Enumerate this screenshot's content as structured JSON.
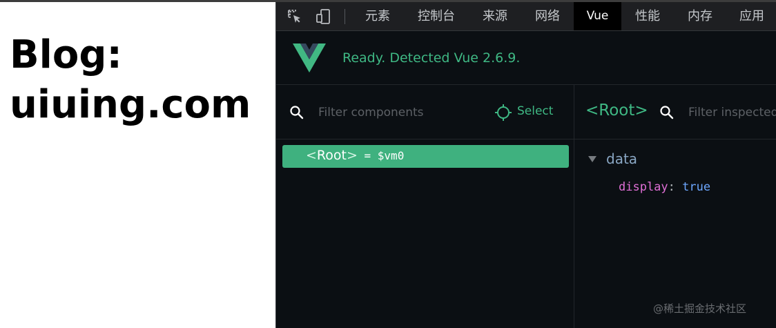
{
  "page": {
    "heading_line1": "Blog:",
    "heading_line2": "uiuing.com"
  },
  "devtools": {
    "tools": [
      {
        "icon": "inspect-element-icon"
      },
      {
        "icon": "device-toolbar-icon"
      }
    ],
    "tabs": [
      {
        "label": "元素",
        "active": false
      },
      {
        "label": "控制台",
        "active": false
      },
      {
        "label": "来源",
        "active": false
      },
      {
        "label": "网络",
        "active": false
      },
      {
        "label": "Vue",
        "active": true
      },
      {
        "label": "性能",
        "active": false
      },
      {
        "label": "内存",
        "active": false
      },
      {
        "label": "应用",
        "active": false
      }
    ],
    "colors": {
      "vue_green": "#3fb884",
      "panel_bg": "#0b0f13",
      "tab_bar_bg": "#1e1f22",
      "selected_row": "#3fb17f",
      "prop_key": "#e06fd6",
      "prop_value": "#6da7ff",
      "section_label": "#8aa7c4"
    }
  },
  "vue_panel": {
    "status": "Ready. Detected Vue 2.6.9.",
    "components": {
      "filter_placeholder": "Filter components",
      "select_label": "Select",
      "tree": [
        {
          "open": "<",
          "name": "Root",
          "close": ">",
          "suffix": " = $vm0",
          "selected": true
        }
      ]
    },
    "inspector": {
      "title": "<Root>",
      "filter_placeholder": "Filter inspected data",
      "sections": [
        {
          "label": "data",
          "expanded": true,
          "props": [
            {
              "key": "display",
              "value": "true"
            }
          ]
        }
      ]
    }
  },
  "watermark": "@稀土掘金技术社区"
}
